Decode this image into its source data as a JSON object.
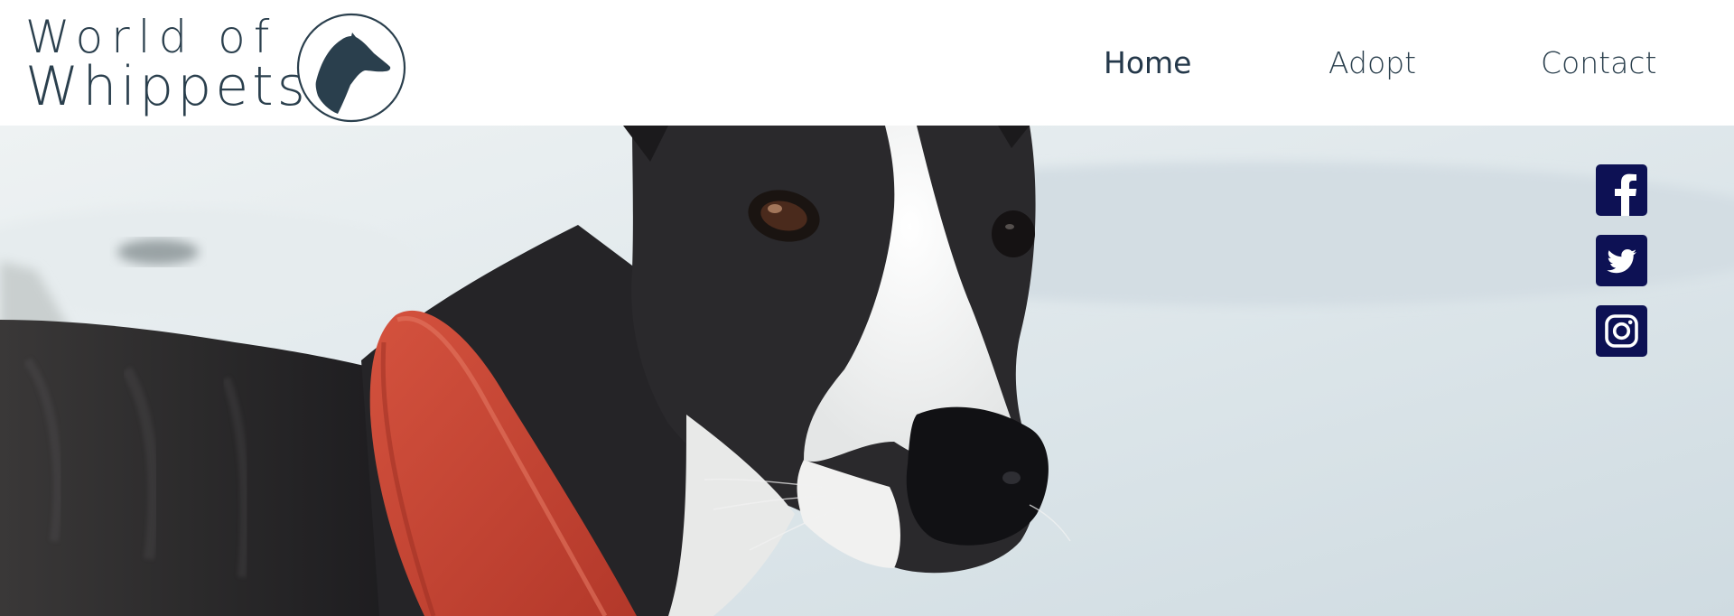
{
  "brand": {
    "line1": "World of",
    "line2": "Whippets",
    "logo_icon": "whippet-head-icon",
    "color": "#2a3f4d"
  },
  "nav": {
    "items": [
      {
        "label": "Home",
        "active": true
      },
      {
        "label": "Adopt",
        "active": false
      },
      {
        "label": "Contact",
        "active": false
      }
    ]
  },
  "hero": {
    "image": "whippet-with-red-collar-photo",
    "collar_color": "#c4402f"
  },
  "social": {
    "color": "#0d1154",
    "icons": [
      "facebook-icon",
      "twitter-icon",
      "instagram-icon"
    ]
  }
}
